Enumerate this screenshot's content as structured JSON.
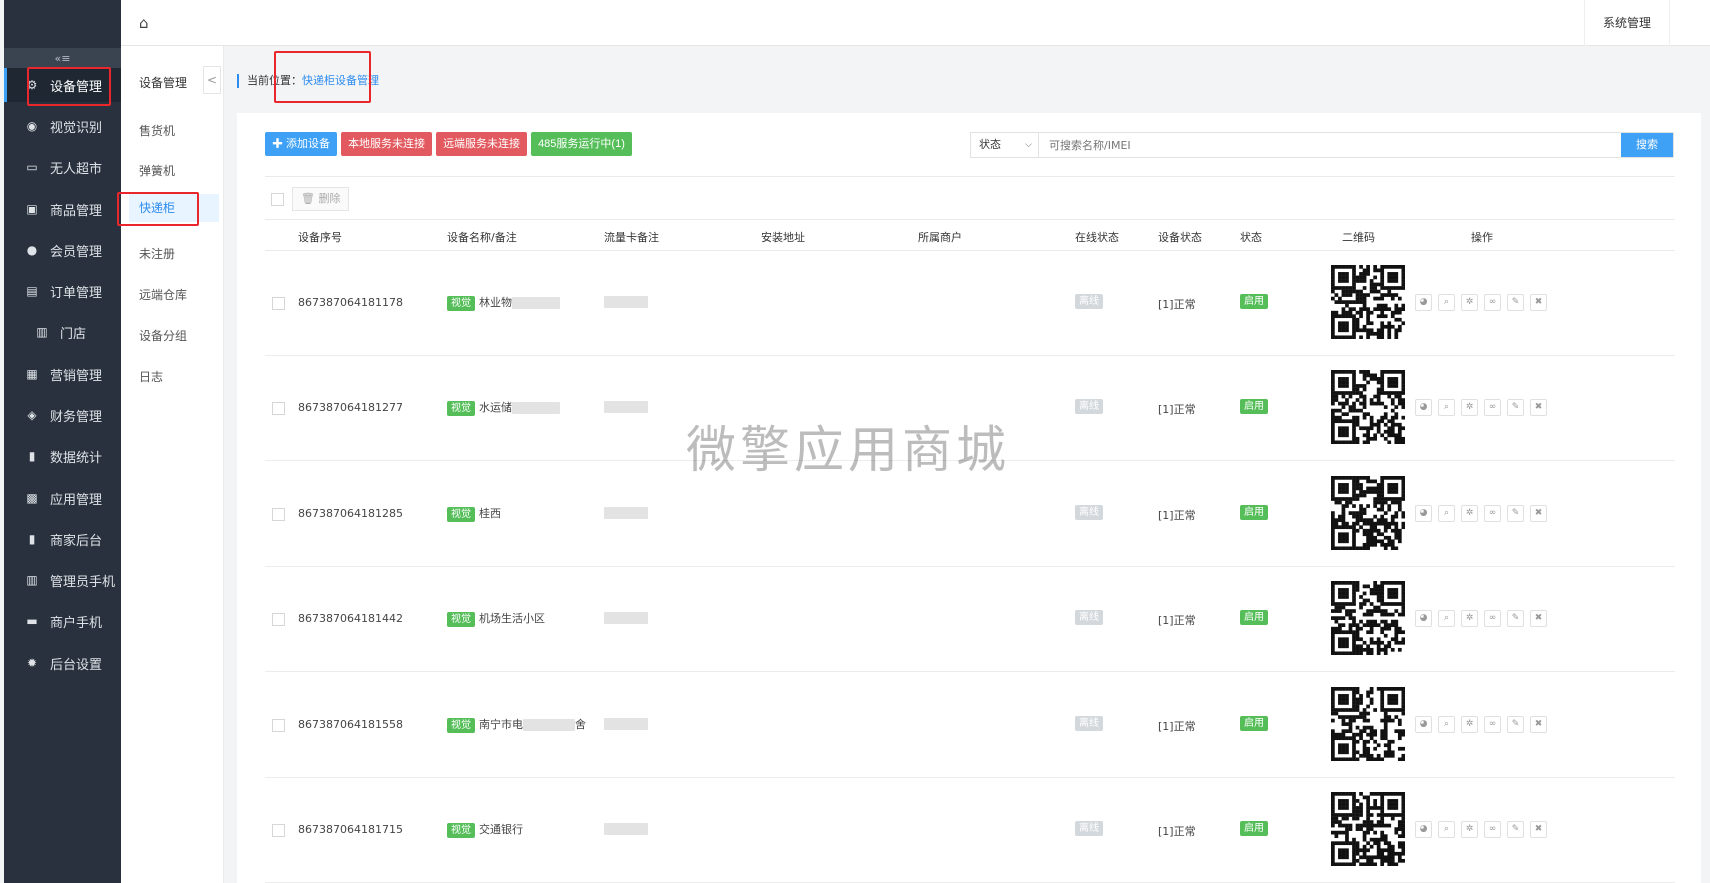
{
  "sidebar": {
    "collapse_icon": "«≡",
    "items": [
      {
        "label": "设备管理",
        "icon": "devices-icon",
        "glyph": "⚙",
        "active": true
      },
      {
        "label": "视觉识别",
        "icon": "eye-icon",
        "glyph": "◉"
      },
      {
        "label": "无人超市",
        "icon": "monitor-icon",
        "glyph": "▭"
      },
      {
        "label": "商品管理",
        "icon": "product-icon",
        "glyph": "▣"
      },
      {
        "label": "会员管理",
        "icon": "user-icon",
        "glyph": "●"
      },
      {
        "label": "订单管理",
        "icon": "order-icon",
        "glyph": "▤"
      },
      {
        "label": "门店",
        "icon": "store-icon",
        "glyph": "▥",
        "sub": true
      },
      {
        "label": "营销管理",
        "icon": "gift-icon",
        "glyph": "▦"
      },
      {
        "label": "财务管理",
        "icon": "moneybag-icon",
        "glyph": "◈"
      },
      {
        "label": "数据统计",
        "icon": "bar-chart-icon",
        "glyph": "▮"
      },
      {
        "label": "应用管理",
        "icon": "apps-icon",
        "glyph": "▩"
      },
      {
        "label": "商家后台",
        "icon": "bar-chart-icon",
        "glyph": "▮"
      },
      {
        "label": "管理员手机",
        "icon": "store-icon",
        "glyph": "▥"
      },
      {
        "label": "商户手机",
        "icon": "shop-icon",
        "glyph": "▬"
      },
      {
        "label": "后台设置",
        "icon": "gear-icon",
        "glyph": "✹"
      }
    ]
  },
  "header": {
    "home_icon": "⌂",
    "system_menu": "系统管理"
  },
  "submenu": {
    "title": "设备管理",
    "collapse": "<",
    "items": [
      {
        "label": "售货机"
      },
      {
        "label": "弹簧机"
      },
      {
        "label": "快递柜",
        "active": true
      },
      {
        "label": "未注册"
      },
      {
        "label": "远端仓库"
      },
      {
        "label": "设备分组"
      },
      {
        "label": "日志"
      }
    ]
  },
  "breadcrumb": {
    "prefix": "当前位置：",
    "current": "快递柜设备管理"
  },
  "toolbar": {
    "add_label": "✚ 添加设备",
    "local_label": "本地服务未连接",
    "remote_label": "远端服务未连接",
    "service_label": "485服务运行中(1)"
  },
  "search": {
    "status_label": "状态",
    "placeholder": "可搜索名称/IMEI",
    "button": "搜索"
  },
  "bulk": {
    "delete_label": "🗑 删除"
  },
  "table": {
    "columns": [
      "设备序号",
      "设备名称/备注",
      "流量卡备注",
      "安装地址",
      "所属商户",
      "在线状态",
      "设备状态",
      "状态",
      "二维码",
      "操作"
    ],
    "rows": [
      {
        "serial": "867387064181178",
        "tag": "视觉",
        "name": "林业物",
        "online": "离线",
        "device_status": "[1]正常",
        "status": "启用"
      },
      {
        "serial": "867387064181277",
        "tag": "视觉",
        "name": "水运储",
        "online": "离线",
        "device_status": "[1]正常",
        "status": "启用"
      },
      {
        "serial": "867387064181285",
        "tag": "视觉",
        "name": "桂西",
        "online": "离线",
        "device_status": "[1]正常",
        "status": "启用"
      },
      {
        "serial": "867387064181442",
        "tag": "视觉",
        "name": "机场生活小区",
        "online": "离线",
        "device_status": "[1]正常",
        "status": "启用"
      },
      {
        "serial": "867387064181558",
        "tag": "视觉",
        "name": "南宁市电",
        "name_tail": "舍",
        "online": "离线",
        "device_status": "[1]正常",
        "status": "启用"
      },
      {
        "serial": "867387064181715",
        "tag": "视觉",
        "name": "交通银行",
        "online": "离线",
        "device_status": "[1]正常",
        "status": "启用"
      }
    ],
    "row_actions": [
      {
        "icon": "pie-chart-icon",
        "glyph": "◕"
      },
      {
        "icon": "search-icon",
        "glyph": "⌕"
      },
      {
        "icon": "gear-icon",
        "glyph": "✲"
      },
      {
        "icon": "link-icon",
        "glyph": "∞"
      },
      {
        "icon": "edit-icon",
        "glyph": "✎"
      },
      {
        "icon": "trash-icon",
        "glyph": "✖"
      }
    ]
  },
  "watermark": "微擎应用商城"
}
